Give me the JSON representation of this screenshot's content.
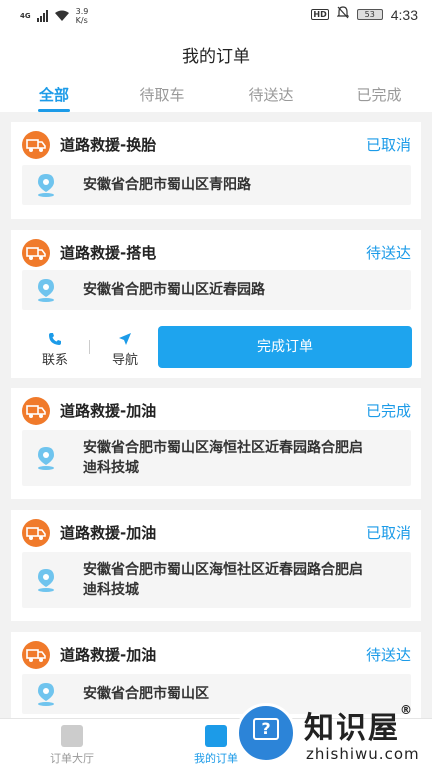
{
  "status_bar": {
    "network": "4G",
    "speed_value": "3.9",
    "speed_unit": "K/s",
    "hd": "HD",
    "battery": "53",
    "time": "4:33"
  },
  "page_title": "我的订单",
  "tabs": [
    {
      "label": "全部",
      "active": true
    },
    {
      "label": "待取车",
      "active": false
    },
    {
      "label": "待送达",
      "active": false
    },
    {
      "label": "已完成",
      "active": false
    }
  ],
  "orders": [
    {
      "service": "道路救援-换胎",
      "status": "已取消",
      "address_lines": [
        "安徽省合肥市蜀山区青阳路"
      ]
    },
    {
      "service": "道路救援-搭电",
      "status": "待送达",
      "address_lines": [
        "安徽省合肥市蜀山区近春园路"
      ]
    },
    {
      "service": "道路救援-加油",
      "status": "已完成",
      "address_lines": [
        "安徽省合肥市蜀山区海恒社区近春园路合肥启",
        "迪科技城"
      ]
    },
    {
      "service": "道路救援-加油",
      "status": "已取消",
      "address_lines": [
        "安徽省合肥市蜀山区海恒社区近春园路合肥启",
        "迪科技城"
      ]
    },
    {
      "service": "道路救援-加油",
      "status": "待送达",
      "address_lines": [
        "安徽省合肥市蜀山区"
      ]
    }
  ],
  "order_actions": {
    "contact": "联系",
    "navigate": "导航",
    "complete": "完成订单"
  },
  "tabbar": [
    {
      "label": "订单大厅",
      "active": false
    },
    {
      "label": "我的订单",
      "active": true
    }
  ],
  "watermark": {
    "title": "知识屋",
    "registered": "®",
    "url": "zhishiwu.com"
  },
  "colors": {
    "accent": "#1c9be8",
    "button": "#1ea4ee",
    "car_icon": "#f07a2b",
    "pin": "#6fc4ee"
  }
}
